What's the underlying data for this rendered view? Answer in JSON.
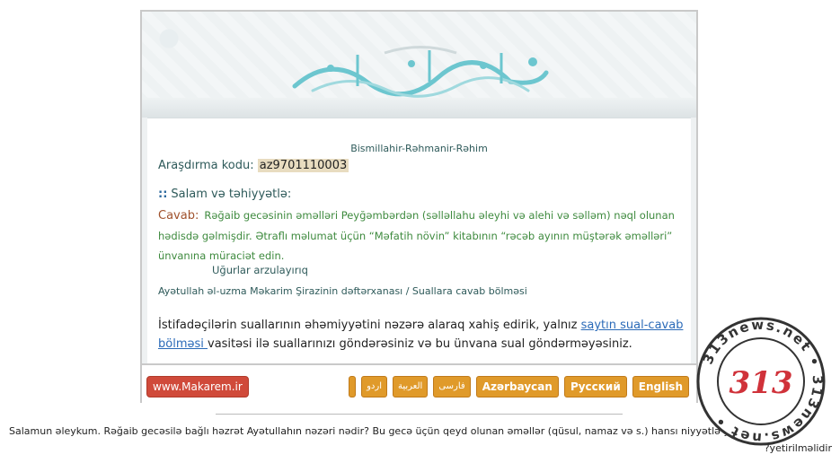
{
  "banner": {
    "calligraphy_icon": "arabic-calligraphy-logo"
  },
  "content": {
    "bismillah": "Bismillahir-Rəhmanir-Rəhim",
    "code_label": "Araşdırma kodu:",
    "code_value": "az9701110003",
    "salam": "Salam və təhiyyətlə:",
    "answer_label": "Cavab:",
    "answer_text": "Rəğaib gecəsinin əməlləri Peyğəmbərdən (səlləllahu əleyhi və alehi və səlləm) nəql olunan hədisdə gəlmişdir. Ətraflı məlumat üçün “Məfatih növin” kitabının “rəcəb ayının müştərək əməlləri” ünvanına müraciət edin.",
    "wish": "Uğurlar arzulayırıq",
    "signature": "Ayətullah əl-uzma Məkarim Şirazinin dəftərxanası / Suallara cavab bölməsi",
    "notice_before": "İstifadəçilərin suallarının əhəmiyyətini nəzərə alaraq xahiş edirik, yalnız ",
    "notice_link": "saytın sual-cavab bölməsi ",
    "notice_after": "vasitəsi ilə suallarınızı göndərəsiniz və bu ünvana sual göndərməyəsiniz."
  },
  "footer": {
    "site_button": "www.Makarem.ir",
    "lang_blank": "",
    "lang_urdu": "اردو",
    "lang_arabic": "العربية",
    "lang_farsi": "فارسی",
    "lang_az": "Azərbaycan",
    "lang_ru": "Русский",
    "lang_en": "English"
  },
  "question": {
    "text": "Salamun əleykum. Rəğaib gecəsilə bağlı həzrət Ayətullahın nəzəri nədir? Bu gecə üçün qeyd olunan əməllər (qüsul, namaz və s.) hansı niyyətlə yerinə",
    "last_line": "?yetirilməlidir"
  },
  "stamp": {
    "text": "313news.net",
    "number": "313",
    "colors": {
      "ring": "#333333",
      "number": "#d0323a"
    }
  },
  "colors": {
    "accent_green": "#3e8a3e",
    "label_brown": "#a0522d",
    "button_orange": "#e09a2a",
    "button_red": "#d04a3a"
  }
}
